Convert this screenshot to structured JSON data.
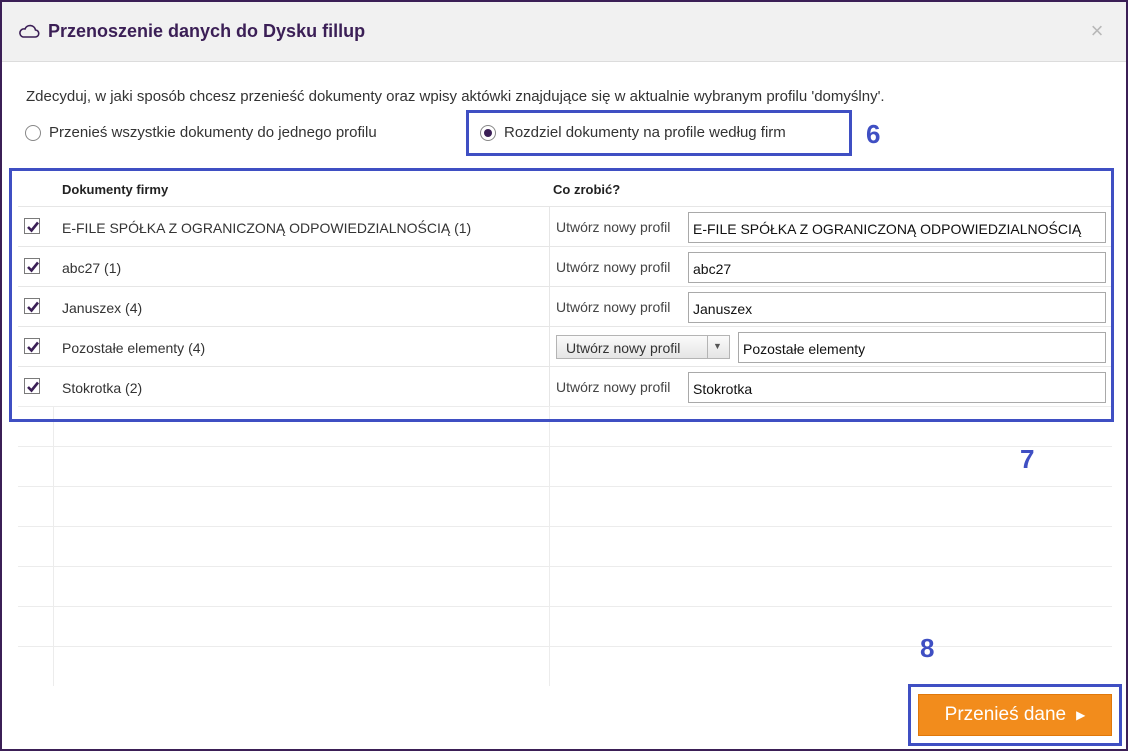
{
  "dialog": {
    "title": "Przenoszenie danych do Dysku fillup",
    "close_symbol": "×",
    "icon": "cloud-icon"
  },
  "intro_text": "Zdecyduj, w jaki sposób chcesz przenieść dokumenty oraz wpisy aktówki znajdujące się w aktualnie wybranym profilu 'domyślny'.",
  "options": [
    {
      "label": "Przenieś wszystkie dokumenty do jednego profilu",
      "selected": false
    },
    {
      "label": "Rozdziel dokumenty na profile według firm",
      "selected": true
    }
  ],
  "table": {
    "headers": {
      "documents": "Dokumenty firmy",
      "action": "Co zrobić?"
    },
    "rows": [
      {
        "checked": true,
        "name": "E-FILE SPÓŁKA Z OGRANICZONĄ ODPOWIEDZIALNOŚCIĄ (1)",
        "action": "Utwórz nowy profil",
        "action_type": "label",
        "value": "E-FILE SPÓŁKA Z OGRANICZONĄ ODPOWIEDZIALNOŚCIĄ"
      },
      {
        "checked": true,
        "name": "abc27 (1)",
        "action": "Utwórz nowy profil",
        "action_type": "label",
        "value": "abc27"
      },
      {
        "checked": true,
        "name": "Januszex (4)",
        "action": "Utwórz nowy profil",
        "action_type": "label",
        "value": "Januszex"
      },
      {
        "checked": true,
        "name": "Pozostałe elementy (4)",
        "action": "Utwórz nowy profil",
        "action_type": "select",
        "value": "Pozostałe elementy"
      },
      {
        "checked": true,
        "name": "Stokrotka (2)",
        "action": "Utwórz nowy profil",
        "action_type": "label",
        "value": "Stokrotka"
      }
    ]
  },
  "annotations": {
    "n6": "6",
    "n7": "7",
    "n8": "8"
  },
  "footer": {
    "submit_label": "Przenieś dane",
    "submit_arrow": "▶"
  },
  "colors": {
    "accent": "#3b1f56",
    "button": "#f28c1c",
    "highlight": "#3f4fc3"
  }
}
